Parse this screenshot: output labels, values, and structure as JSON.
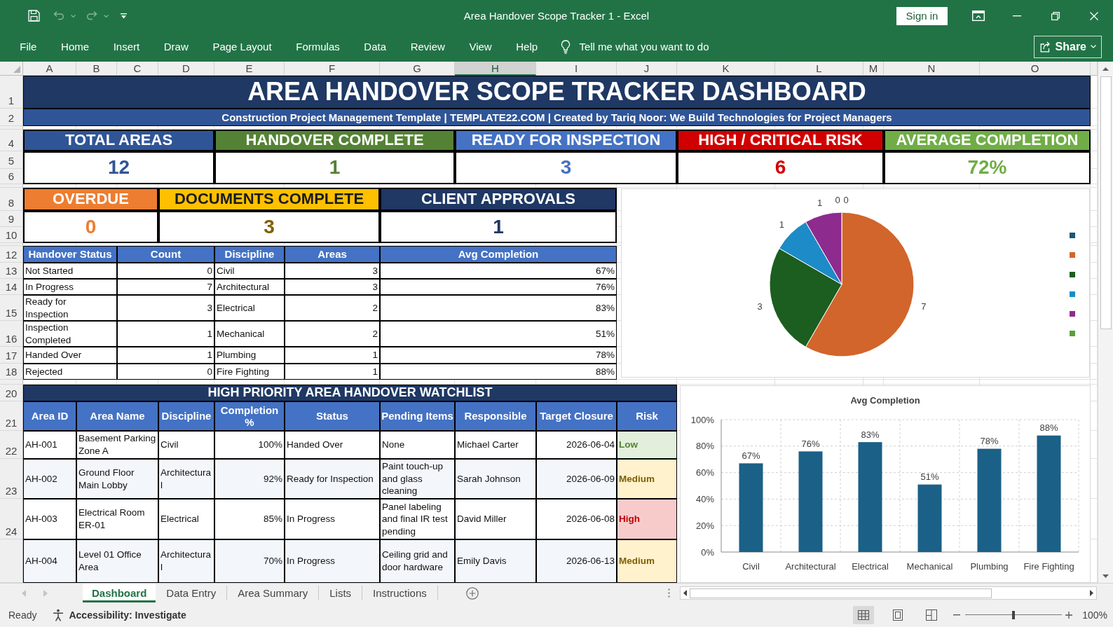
{
  "window": {
    "title": "Area Handover Scope Tracker 1 - Excel"
  },
  "quick_access": [
    {
      "kind": "save",
      "disabled": false
    },
    {
      "kind": "undo",
      "disabled": true
    },
    {
      "kind": "redo",
      "disabled": true
    },
    {
      "kind": "customize",
      "disabled": false
    }
  ],
  "sign_in_button": "Sign in",
  "menu": [
    "File",
    "Home",
    "Insert",
    "Draw",
    "Page Layout",
    "Formulas",
    "Data",
    "Review",
    "View",
    "Help"
  ],
  "tell_me": {
    "placeholder": "Tell me what you want to do"
  },
  "share_button": "Share",
  "sheet": {
    "columns": [
      {
        "label": "A",
        "selected": false
      },
      {
        "label": "B",
        "selected": false
      },
      {
        "label": "C",
        "selected": false
      },
      {
        "label": "D",
        "selected": false
      },
      {
        "label": "E",
        "selected": false
      },
      {
        "label": "F",
        "selected": false
      },
      {
        "label": "G",
        "selected": false
      },
      {
        "label": "H",
        "selected": true
      },
      {
        "label": "I",
        "selected": false
      },
      {
        "label": "J",
        "selected": false
      },
      {
        "label": "K",
        "selected": false
      },
      {
        "label": "L",
        "selected": false
      },
      {
        "label": "M",
        "selected": false
      },
      {
        "label": "N",
        "selected": false
      },
      {
        "label": "O",
        "selected": false
      }
    ],
    "row_numbers": [
      "1",
      "2",
      "4",
      "5",
      "6",
      "8",
      "9",
      "10",
      "12",
      "13",
      "14",
      "15",
      "16",
      "17",
      "18",
      "20",
      "21",
      "22",
      "23",
      "24"
    ],
    "title": "AREA HANDOVER SCOPE TRACKER DASHBOARD",
    "subtitle": "Construction Project Management Template | TEMPLATE22.COM | Created by Tariq Noor: We Build Technologies for Project Managers",
    "kpis": [
      {
        "label": "TOTAL AREAS",
        "value": "12",
        "color": "#2f5597"
      },
      {
        "label": "HANDOVER COMPLETE",
        "value": "1",
        "color": "#548235"
      },
      {
        "label": "READY FOR INSPECTION",
        "value": "3",
        "color": "#4472c4"
      },
      {
        "label": "HIGH / CRITICAL RISK",
        "value": "6",
        "color": "#d00000"
      },
      {
        "label": "AVERAGE COMPLETION",
        "value": "72%",
        "color": "#70ad47"
      }
    ],
    "kpis_secondary": [
      {
        "label": "OVERDUE",
        "value": "0",
        "color": "#ed7d31"
      },
      {
        "label": "DOCUMENTS COMPLETE",
        "value": "3",
        "color": "#ffc000"
      },
      {
        "label": "CLIENT APPROVALS",
        "value": "1",
        "color": "#1f3864"
      }
    ],
    "status_summary": {
      "columns": [
        "Handover Status",
        "Count"
      ],
      "rows": [
        {
          "status": "Not Started",
          "count": "0"
        },
        {
          "status": "In Progress",
          "count": "7"
        },
        {
          "status": "Ready for Inspection",
          "count": "3"
        },
        {
          "status": "Inspection Completed",
          "count": "1"
        },
        {
          "status": "Handed Over",
          "count": "1"
        },
        {
          "status": "Rejected",
          "count": "0"
        }
      ]
    },
    "discipline_summary": {
      "columns": [
        "Discipline",
        "Areas",
        "Avg Completion"
      ],
      "rows": [
        {
          "discipline": "Civil",
          "areas": "3",
          "avg_completion": "67%"
        },
        {
          "discipline": "Architectural",
          "areas": "3",
          "avg_completion": "76%"
        },
        {
          "discipline": "Electrical",
          "areas": "2",
          "avg_completion": "83%"
        },
        {
          "discipline": "Mechanical",
          "areas": "2",
          "avg_completion": "51%"
        },
        {
          "discipline": "Plumbing",
          "areas": "1",
          "avg_completion": "78%"
        },
        {
          "discipline": "Fire Fighting",
          "areas": "1",
          "avg_completion": "88%"
        }
      ]
    },
    "status_chart": {
      "chart_data": {
        "type": "pie",
        "values": [
          0,
          7,
          3,
          1,
          1,
          0
        ],
        "value_labels": [
          "0",
          "7",
          "3",
          "1",
          "1",
          "0"
        ]
      },
      "legend": [
        {
          "color": "#1b5775"
        },
        {
          "color": "#d2652b"
        },
        {
          "color": "#1b5e20"
        },
        {
          "color": "#1d8bc7"
        },
        {
          "color": "#8e2b8f"
        },
        {
          "color": "#5b9f3b"
        }
      ]
    },
    "watchlist": {
      "title": "HIGH PRIORITY AREA HANDOVER WATCHLIST",
      "columns": [
        "Area ID",
        "Area Name",
        "Discipline",
        "Completion %",
        "Status",
        "Pending Items",
        "Responsible",
        "Target Closure",
        "Risk"
      ],
      "rows": [
        {
          "area_id": "AH-001",
          "area_name": "Basement Parking Zone A",
          "discipline": "Civil",
          "completion": "100%",
          "status": "Handed Over",
          "pending_items": "None",
          "responsible": "Michael Carter",
          "target_closure": "2026-06-04",
          "risk": {
            "text": "Low",
            "kind": "low"
          }
        },
        {
          "area_id": "AH-002",
          "area_name": "Ground Floor Main Lobby",
          "discipline": "Architectural",
          "completion": "92%",
          "status": "Ready for Inspection",
          "pending_items": "Paint touch-up and glass cleaning",
          "responsible": "Sarah Johnson",
          "target_closure": "2026-06-09",
          "risk": {
            "text": "Medium",
            "kind": "medium"
          }
        },
        {
          "area_id": "AH-003",
          "area_name": "Electrical Room ER-01",
          "discipline": "Electrical",
          "completion": "85%",
          "status": "In Progress",
          "pending_items": "Panel labeling and final IR test pending",
          "responsible": "David Miller",
          "target_closure": "2026-06-08",
          "risk": {
            "text": "High",
            "kind": "high"
          }
        },
        {
          "area_id": "AH-004",
          "area_name": "Level 01 Office Area",
          "discipline": "Architectural",
          "completion": "70%",
          "status": "In Progress",
          "pending_items": "Ceiling grid and door hardware",
          "responsible": "Emily Davis",
          "target_closure": "2026-06-13",
          "risk": {
            "text": "Medium",
            "kind": "medium"
          }
        }
      ]
    },
    "completion_chart": {
      "chart_data": {
        "type": "bar",
        "title": "Avg Completion",
        "categories": [
          "Civil",
          "Architectural",
          "Electrical",
          "Mechanical",
          "Plumbing",
          "Fire Fighting"
        ],
        "values": [
          0.67,
          0.76,
          0.83,
          0.51,
          0.78,
          0.88
        ],
        "ylim": [
          0,
          1
        ],
        "yticks": [
          {
            "value": 0,
            "label": "0%"
          },
          {
            "value": 0.2,
            "label": "20%"
          },
          {
            "value": 0.4,
            "label": "40%"
          },
          {
            "value": 0.6,
            "label": "60%"
          },
          {
            "value": 0.8,
            "label": "80%"
          },
          {
            "value": 1,
            "label": "100%"
          }
        ],
        "grid": true,
        "value_labels": [
          "67%",
          "76%",
          "83%",
          "51%",
          "78%",
          "88%"
        ]
      }
    }
  },
  "sheet_tabs": [
    {
      "label": "Dashboard",
      "selected": true
    },
    {
      "label": "Data Entry",
      "selected": false
    },
    {
      "label": "Area Summary",
      "selected": false
    },
    {
      "label": "Lists",
      "selected": false
    },
    {
      "label": "Instructions",
      "selected": false
    }
  ],
  "status_bar": {
    "status": "Ready",
    "accessibility": "Accessibility: Investigate",
    "view_buttons": [
      {
        "kind": "normal",
        "selected": true
      },
      {
        "kind": "page_layout",
        "selected": false
      },
      {
        "kind": "page_break",
        "selected": false
      }
    ],
    "zoom_slider": {
      "level": 0.5
    },
    "zoom_level": "100%"
  }
}
